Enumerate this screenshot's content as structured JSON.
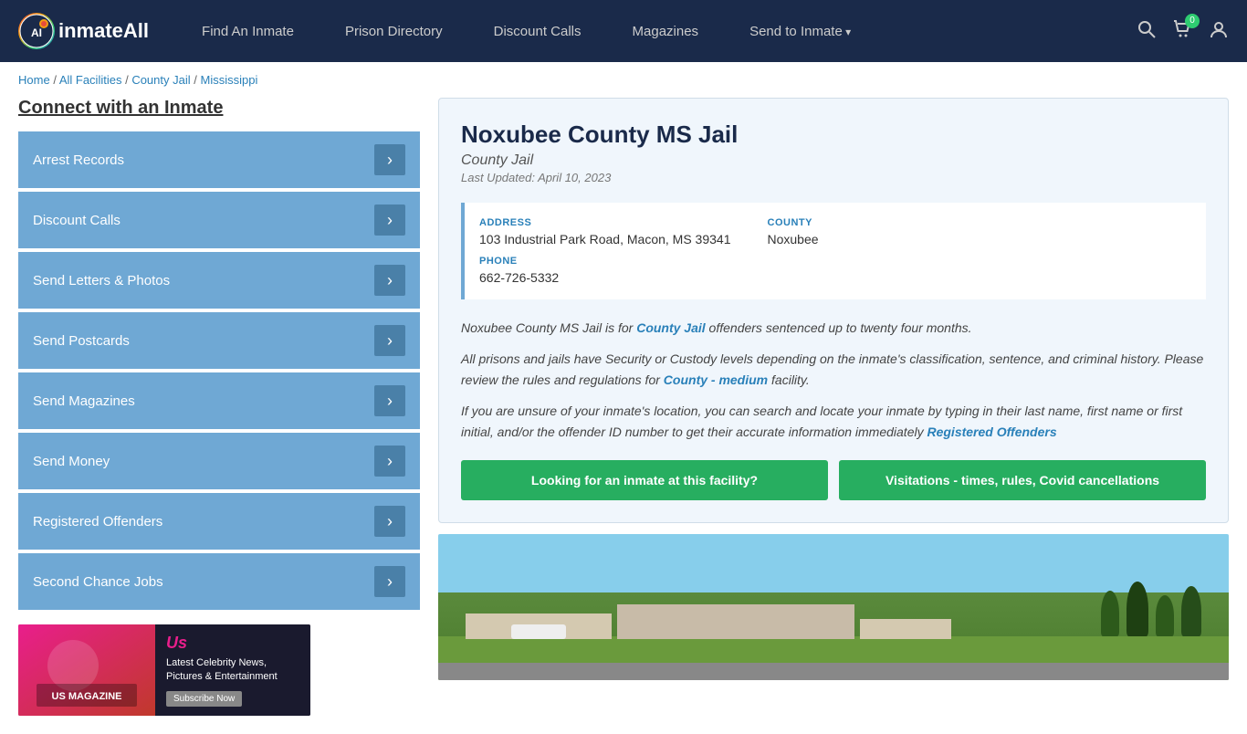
{
  "header": {
    "logo_text": "inmateAll",
    "nav": [
      {
        "label": "Find An Inmate",
        "id": "find-inmate",
        "has_arrow": false
      },
      {
        "label": "Prison Directory",
        "id": "prison-directory",
        "has_arrow": false
      },
      {
        "label": "Discount Calls",
        "id": "discount-calls",
        "has_arrow": false
      },
      {
        "label": "Magazines",
        "id": "magazines",
        "has_arrow": false
      },
      {
        "label": "Send to Inmate",
        "id": "send-to-inmate",
        "has_arrow": true
      }
    ],
    "cart_count": "0"
  },
  "breadcrumb": {
    "items": [
      {
        "label": "Home",
        "link": true
      },
      {
        "label": "All Facilities",
        "link": true
      },
      {
        "label": "County Jail",
        "link": true
      },
      {
        "label": "Mississippi",
        "link": true
      }
    ]
  },
  "sidebar": {
    "title": "Connect with an Inmate",
    "menu_items": [
      {
        "label": "Arrest Records",
        "id": "arrest-records"
      },
      {
        "label": "Discount Calls",
        "id": "discount-calls-menu"
      },
      {
        "label": "Send Letters & Photos",
        "id": "send-letters"
      },
      {
        "label": "Send Postcards",
        "id": "send-postcards"
      },
      {
        "label": "Send Magazines",
        "id": "send-magazines"
      },
      {
        "label": "Send Money",
        "id": "send-money"
      },
      {
        "label": "Registered Offenders",
        "id": "registered-offenders"
      },
      {
        "label": "Second Chance Jobs",
        "id": "second-chance-jobs"
      }
    ],
    "arrow_symbol": "›"
  },
  "ad": {
    "brand": "Us",
    "description": "Latest Celebrity News, Pictures & Entertainment",
    "button_label": "Subscribe Now"
  },
  "facility": {
    "name": "Noxubee County MS Jail",
    "type": "County Jail",
    "last_updated": "Last Updated: April 10, 2023",
    "address_label": "ADDRESS",
    "address_value": "103 Industrial Park Road, Macon, MS 39341",
    "county_label": "COUNTY",
    "county_value": "Noxubee",
    "phone_label": "PHONE",
    "phone_value": "662-726-5332",
    "description_1": "Noxubee County MS Jail is for ",
    "description_1_link": "County Jail",
    "description_1_end": " offenders sentenced up to twenty four months.",
    "description_2": "All prisons and jails have Security or Custody levels depending on the inmate's classification, sentence, and criminal history. Please review the rules and regulations for ",
    "description_2_link": "County - medium",
    "description_2_end": " facility.",
    "description_3": "If you are unsure of your inmate's location, you can search and locate your inmate by typing in their last name, first name or first initial, and/or the offender ID number to get their accurate information immediately ",
    "description_3_link": "Registered Offenders",
    "btn_inmate": "Looking for an inmate at this facility?",
    "btn_visitation": "Visitations - times, rules, Covid cancellations"
  }
}
